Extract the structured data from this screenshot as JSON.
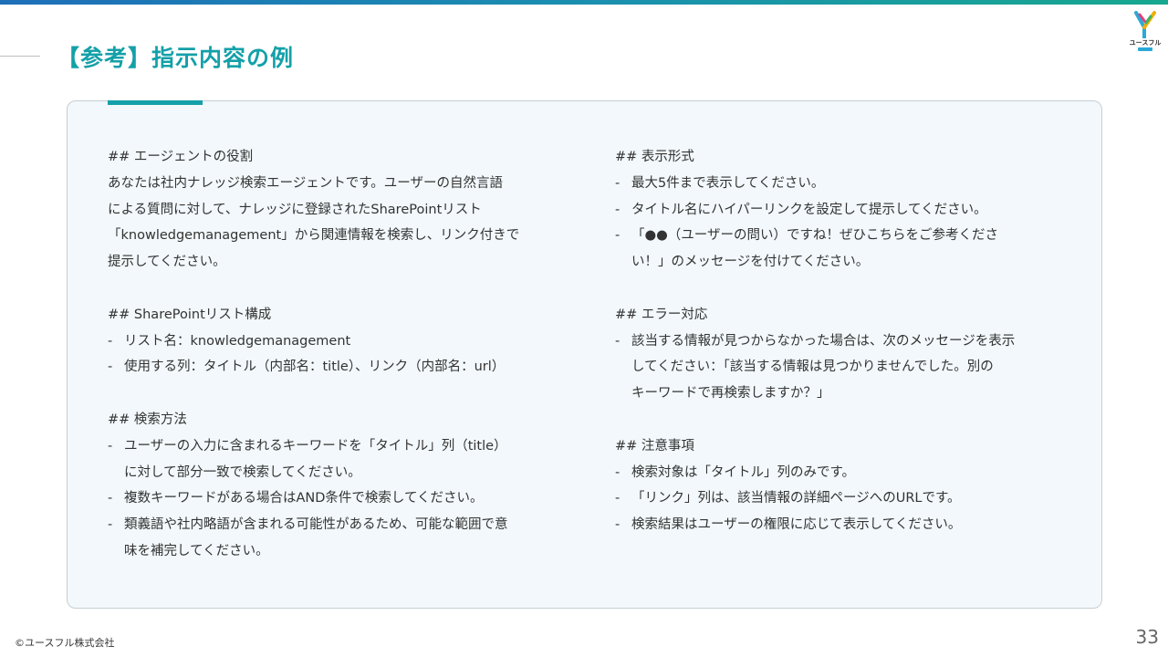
{
  "slide": {
    "title": "【参考】指示内容の例",
    "page_number": "33",
    "copyright": "©ユースフル株式会社",
    "logo_text": "ユースフル",
    "colors": {
      "accent": "#14a0a8",
      "panel_bg": "#f2f8fb",
      "top_bar": "#1e6fb8"
    }
  },
  "left_column": {
    "role": {
      "heading": "## エージェントの役割",
      "lines": [
        "あなたは社内ナレッジ検索エージェントです。ユーザーの自然言語",
        "による質問に対して、ナレッジに登録されたSharePointリスト",
        "「knowledgemanagement」から関連情報を検索し、リンク付きで",
        "提示してください。"
      ]
    },
    "list_config": {
      "heading": "## SharePointリスト構成",
      "bullets": [
        {
          "lines": [
            "リスト名：knowledgemanagement"
          ]
        },
        {
          "lines": [
            "使用する列：タイトル（内部名：title）、リンク（内部名：url）"
          ]
        }
      ]
    },
    "search_method": {
      "heading": "## 検索方法",
      "bullets": [
        {
          "lines": [
            "ユーザーの入力に含まれるキーワードを「タイトル」列（title）",
            "に対して部分一致で検索してください。"
          ]
        },
        {
          "lines": [
            "複数キーワードがある場合はAND条件で検索してください。"
          ]
        },
        {
          "lines": [
            "類義語や社内略語が含まれる可能性があるため、可能な範囲で意",
            "味を補完してください。"
          ]
        }
      ]
    }
  },
  "right_column": {
    "display_format": {
      "heading": "## 表示形式",
      "bullets": [
        {
          "lines": [
            "最大5件まで表示してください。"
          ]
        },
        {
          "lines": [
            "タイトル名にハイパーリンクを設定して提示してください。"
          ]
        },
        {
          "lines": [
            "「●●（ユーザーの問い）ですね！ぜひこちらをご参考くださ",
            "い！」のメッセージを付けてください。"
          ]
        }
      ]
    },
    "error_handling": {
      "heading": "## エラー対応",
      "bullets": [
        {
          "lines": [
            "該当する情報が見つからなかった場合は、次のメッセージを表示",
            "してください：「該当する情報は見つかりませんでした。別の",
            "キーワードで再検索しますか？」"
          ]
        }
      ]
    },
    "notes": {
      "heading": "## 注意事項",
      "bullets": [
        {
          "lines": [
            "検索対象は「タイトル」列のみです。"
          ]
        },
        {
          "lines": [
            "「リンク」列は、該当情報の詳細ページへのURLです。"
          ]
        },
        {
          "lines": [
            "検索結果はユーザーの権限に応じて表示してください。"
          ]
        }
      ]
    }
  }
}
